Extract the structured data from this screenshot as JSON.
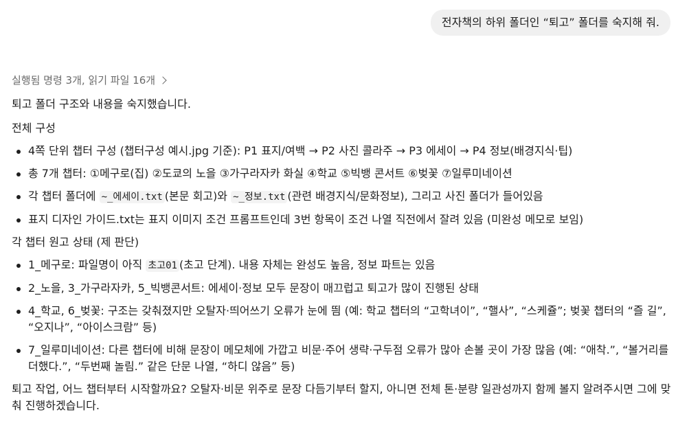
{
  "user_message": "전자책의 하위 폴더인 “퇴고” 폴더를 숙지해 줘.",
  "response": {
    "summary": "실행됨 명령 3개, 읽기 파일 16개",
    "intro": "퇴고 폴더 구조와 내용을 숙지했습니다.",
    "section1_title": "전체 구성",
    "section1_items": {
      "i1": "4쪽 단위 챕터 구성 (챕터구성 예시.jpg 기준): P1 표지/여백 → P2 사진 콜라주 → P3 에세이 → P4 정보(배경지식·팁)",
      "i2": "총 7개 챕터: ①메구로(집) ②도쿄의 노을 ③가구라자카 화실 ④학교 ⑤빅뱅 콘서트 ⑥벚꽃 ⑦일루미네이션",
      "i3_a": "각 챕터 폴더에 ",
      "i3_code1": "~_에세이.txt",
      "i3_b": "(본문 회고)와 ",
      "i3_code2": "~_정보.txt",
      "i3_c": "(관련 배경지식/문화정보), 그리고 사진 폴더가 들어있음",
      "i4": "표지 디자인 가이드.txt는 표지 이미지 조건 프롬프트인데 3번 항목이 조건 나열 직전에서 잘려 있음 (미완성 메모로 보임)"
    },
    "section2_title": "각 챕터 원고 상태 (제 판단)",
    "section2_items": {
      "i1_a": "1_메구로: 파일명이 아직 ",
      "i1_code": "초고01",
      "i1_b": "(초고 단계). 내용 자체는 완성도 높음, 정보 파트는 있음",
      "i2": "2_노을, 3_가구라자카, 5_빅뱅콘서트: 에세이·정보 모두 문장이 매끄럽고 퇴고가 많이 진행된 상태",
      "i3": "4_학교, 6_벚꽃: 구조는 갖춰졌지만 오탈자·띄어쓰기 오류가 눈에 띔 (예: 학교 챕터의 “고학녀이”, “핼사”, “스케쥴”; 벚꽃 챕터의 “즐 길”, “오지나”, “아이스크람” 등)",
      "i4": "7_일루미네이션: 다른 챕터에 비해 문장이 메모체에 가깝고 비문·주어 생략·구두점 오류가 많아 손볼 곳이 가장 많음 (예: “애착.”, “볼거리를 더했다.”, “두번째 놀림.” 같은 단문 나열, “하디 않음” 등)"
    },
    "closing": "퇴고 작업, 어느 챕터부터 시작할까요? 오탈자·비문 위주로 문장 다듬기부터 할지, 아니면 전체 톤·분량 일관성까지 함께 볼지 알려주시면 그에 맞춰 진행하겠습니다."
  }
}
